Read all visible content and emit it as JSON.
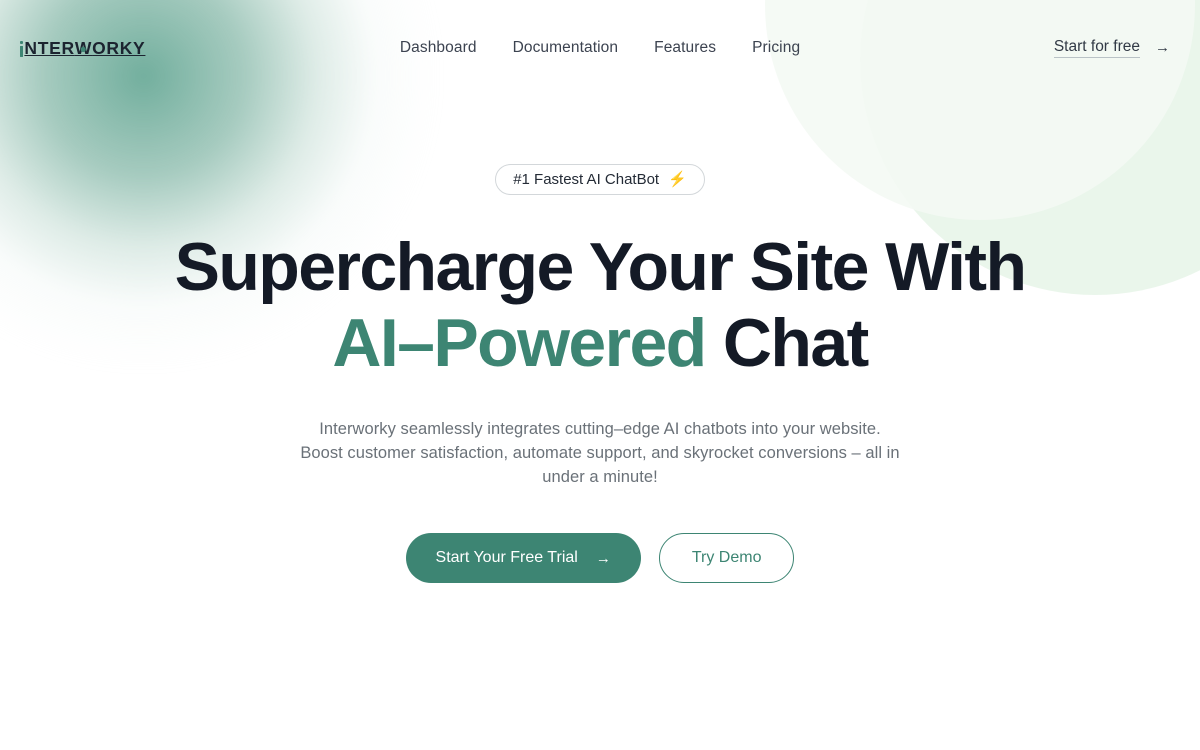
{
  "brand": {
    "name": "iNTERWORKY",
    "logo_i": "i",
    "logo_part1": "NTER",
    "logo_w": "W",
    "logo_part2": "ORKY",
    "accent_color": "#3d8573",
    "headline_color": "#141a26"
  },
  "nav": {
    "items": [
      {
        "label": "Dashboard"
      },
      {
        "label": "Documentation"
      },
      {
        "label": "Features"
      },
      {
        "label": "Pricing"
      }
    ]
  },
  "header_cta": {
    "label": "Start for free",
    "arrow": "→"
  },
  "hero": {
    "badge": {
      "text": "#1 Fastest AI ChatBot",
      "icon": "lightning-bolt-emoji",
      "icon_glyph": "⚡"
    },
    "headline_line1": "Supercharge Your Site With",
    "headline_accent": "AI–Powered",
    "headline_tail": " Chat",
    "subhead": "Interworky seamlessly integrates cutting–edge AI chatbots into your website. Boost customer satisfaction, automate support, and skyrocket conversions – all in under a minute!",
    "primary_button": {
      "label": "Start Your Free Trial",
      "arrow": "→"
    },
    "secondary_button": {
      "label": "Try Demo"
    }
  }
}
